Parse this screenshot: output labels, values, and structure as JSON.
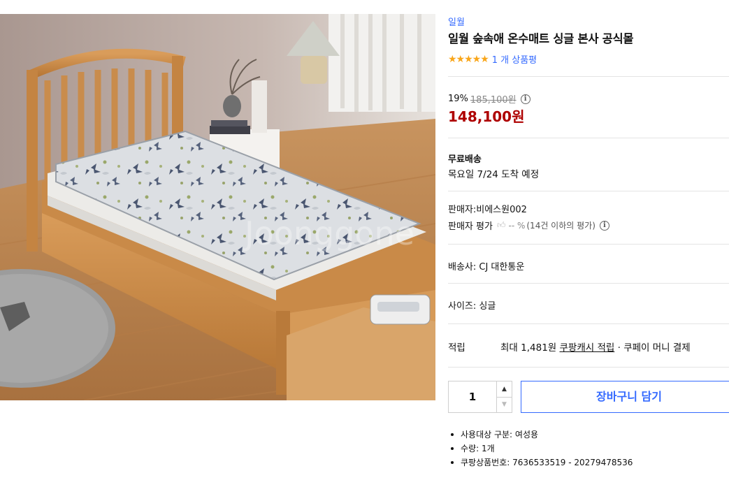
{
  "product": {
    "image_alt": "bed with floral mattress pad",
    "brand": "일월",
    "title": "일월 숲속애 온수매트 싱글 본사 공식몰",
    "rating": {
      "stars": "★★★★★",
      "value": 5,
      "max": 5,
      "review_count": "1 개 상품평"
    }
  },
  "price": {
    "discount": "19%",
    "original": "185,100원",
    "info_icon": "info-icon",
    "sale": "148,100원"
  },
  "shipping": {
    "label": "무료배송",
    "arrival": "목요일 7/24 도착 예정"
  },
  "seller": {
    "name": "판매자:비에스원002",
    "eval_label": "판매자 평가",
    "eval_icon": "thumbs-up-icon",
    "eval_value": "-- %",
    "eval_note": "(14건 이하의 평가)"
  },
  "carrier": {
    "text": "배송사:  CJ 대한통운"
  },
  "option": {
    "size": "사이즈:  싱글"
  },
  "rewards": {
    "label": "적립",
    "max_prefix": "최대 1,481원",
    "cash_link": "쿠팡캐시 적립",
    "tail": "· 쿠페이 머니 결제"
  },
  "purchase": {
    "quantity": "1",
    "up_icon": "chevron-up-icon",
    "down_icon": "chevron-down-icon",
    "cart_label": "장바구니 담기"
  },
  "attributes": [
    "사용대상 구분: 여성용",
    "수량: 1개",
    "쿠팡상품번호: 7636533519 - 20279478536"
  ],
  "colors": {
    "link_blue": "#346aff",
    "price_red": "#ae0000",
    "star_orange": "#f9a61a"
  }
}
